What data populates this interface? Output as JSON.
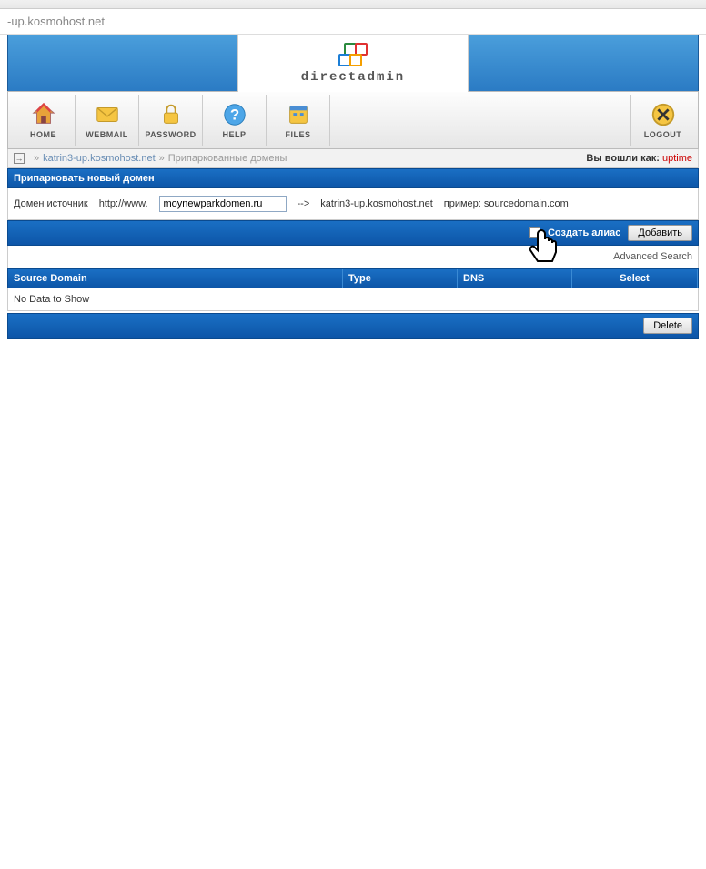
{
  "browser": {
    "url": "-up.kosmohost.net"
  },
  "logo": {
    "text": "directadmin"
  },
  "toolbar": {
    "home": "HOME",
    "webmail": "WEBMAIL",
    "password": "PASSWORD",
    "help": "HELP",
    "files": "FILES",
    "logout": "LOGOUT"
  },
  "breadcrumb": {
    "domain": "katrin3-up.kosmohost.net",
    "page": "Припаркованные домены",
    "login_label": "Вы вошли как:",
    "login_user": "uptime"
  },
  "section": {
    "title": "Припарковать новый домен"
  },
  "form": {
    "source_label": "Домен источник",
    "prefix": "http://www.",
    "domain_value": "moynewparkdomen.ru",
    "arrow": "-->",
    "target": "katrin3-up.kosmohost.net",
    "example": "пример: sourcedomain.com"
  },
  "action": {
    "alias_label": "Создать алиас",
    "add_btn": "Добавить"
  },
  "adv_search": "Advanced Search",
  "table": {
    "source": "Source Domain",
    "type": "Type",
    "dns": "DNS",
    "select": "Select",
    "no_data": "No Data to Show"
  },
  "footer": {
    "delete_btn": "Delete"
  }
}
